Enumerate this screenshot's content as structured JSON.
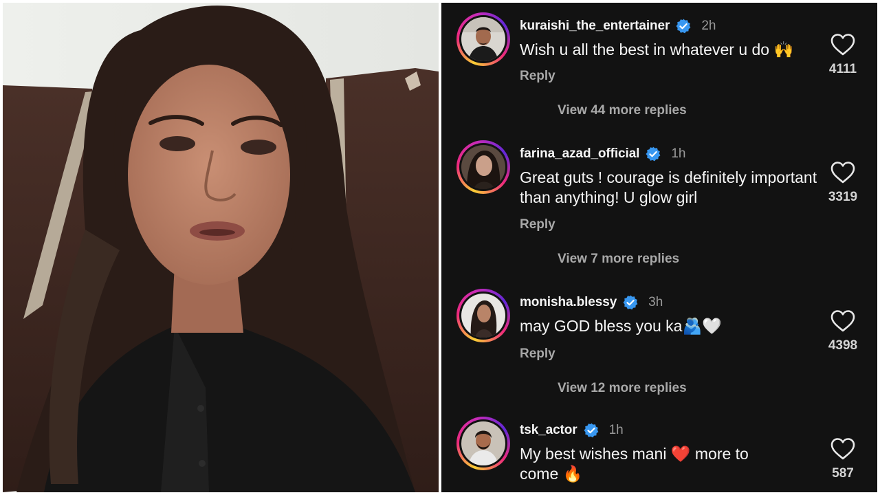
{
  "photo": {
    "subject": "woman-speaking"
  },
  "comments": [
    {
      "username": "kuraishi_the_entertainer",
      "verified": true,
      "time": "2h",
      "text": "Wish u all the best in whatever u do 🙌",
      "reply_label": "Reply",
      "more_replies": "View 44 more replies",
      "likes": "4111",
      "avatar": "avatar-man-black-shirt"
    },
    {
      "username": "farina_azad_official",
      "verified": true,
      "time": "1h",
      "text": "Great guts ! courage is definitely important than anything! U glow girl",
      "reply_label": "Reply",
      "more_replies": "View 7 more replies",
      "likes": "3319",
      "avatar": "avatar-woman-dark-hair"
    },
    {
      "username": "monisha.blessy",
      "verified": true,
      "time": "3h",
      "text": "may GOD bless you ka🫂🤍",
      "reply_label": "Reply",
      "more_replies": "View 12 more replies",
      "likes": "4398",
      "avatar": "avatar-woman-long-hair"
    },
    {
      "username": "tsk_actor",
      "verified": true,
      "time": "1h",
      "text": "My best wishes mani ❤️ more to come 🔥",
      "reply_label": "",
      "more_replies": "",
      "likes": "587",
      "avatar": "avatar-man-beard"
    }
  ],
  "colors": {
    "background": "#121212",
    "verified_badge": "#3897f0",
    "muted_text": "#a8a8a8"
  },
  "icons": {
    "like": "heart-outline-icon",
    "verified": "verified-badge-icon"
  }
}
